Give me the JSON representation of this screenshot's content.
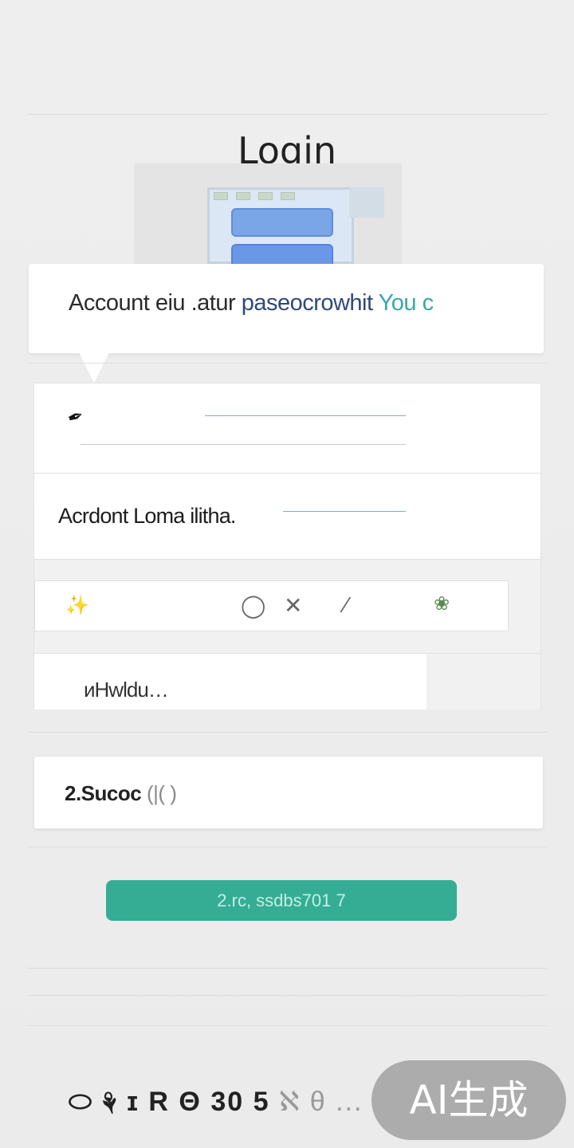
{
  "header": {
    "title": "Login"
  },
  "info": {
    "part1": "Account eiu .atur ",
    "part2": "paseocrowhit",
    "part3": " You c"
  },
  "form": {
    "account_label": "Acrdont Loma ilitha.",
    "hint_text": "иHwldu…"
  },
  "card": {
    "label": "2.Sucoc",
    "suffix": " (|( )"
  },
  "submit": {
    "label": "2.rc, ssdbs701 7"
  },
  "footer": {
    "text": "⬭ ⚘ ɪ R Θ 30 5",
    "faded": " ℵ θ ..."
  },
  "badge": {
    "text": "AI生成"
  },
  "colors": {
    "accent": "#35ad95",
    "link": "#2e4a78",
    "teal_text": "#3aa6a6"
  }
}
